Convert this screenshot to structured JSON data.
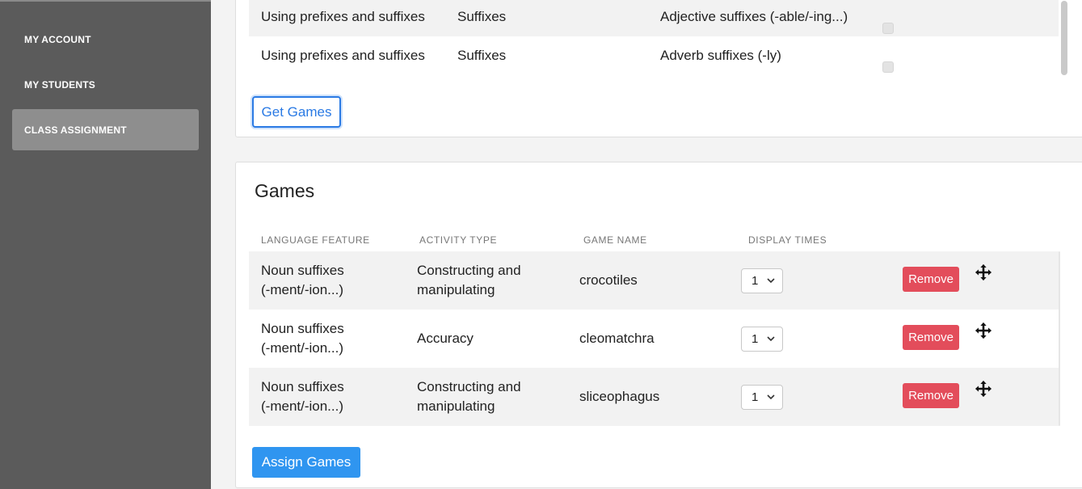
{
  "sidebar": {
    "items": [
      {
        "label": "MY ACCOUNT"
      },
      {
        "label": "MY STUDENTS"
      },
      {
        "label": "CLASS ASSIGNMENT"
      }
    ]
  },
  "features_table": {
    "rows": [
      {
        "topic": "Using prefixes and suffixes",
        "category": "Suffixes",
        "feature": "Adjective suffixes (-able/-ing...)"
      },
      {
        "topic": "Using prefixes and suffixes",
        "category": "Suffixes",
        "feature": "Adverb suffixes (-ly)"
      }
    ],
    "get_games_label": "Get Games"
  },
  "games": {
    "title": "Games",
    "headers": {
      "language_feature": "LANGUAGE FEATURE",
      "activity_type": "ACTIVITY TYPE",
      "game_name": "GAME NAME",
      "display_times": "DISPLAY TIMES"
    },
    "rows": [
      {
        "feature_line1": "Noun suffixes",
        "feature_line2": "(-ment/-ion...)",
        "activity_line1": "Constructing and",
        "activity_line2": "manipulating",
        "game_name": "crocotiles",
        "display_times": "1",
        "remove_label": "Remove"
      },
      {
        "feature_line1": "Noun suffixes",
        "feature_line2": "(-ment/-ion...)",
        "activity_line1": "Accuracy",
        "activity_line2": "",
        "game_name": "cleomatchra",
        "display_times": "1",
        "remove_label": "Remove"
      },
      {
        "feature_line1": "Noun suffixes",
        "feature_line2": "(-ment/-ion...)",
        "activity_line1": "Constructing and",
        "activity_line2": "manipulating",
        "game_name": "sliceophagus",
        "display_times": "1",
        "remove_label": "Remove"
      }
    ],
    "assign_label": "Assign Games"
  },
  "colors": {
    "sidebar_bg": "#5b5b5b",
    "sidebar_active": "#8e8e8e",
    "primary": "#2f95f0",
    "outline_blue": "#2a7ae4",
    "danger": "#e34d5b"
  },
  "icons": {
    "move": "move-arrows-icon",
    "select": "chevron-down-icon"
  }
}
